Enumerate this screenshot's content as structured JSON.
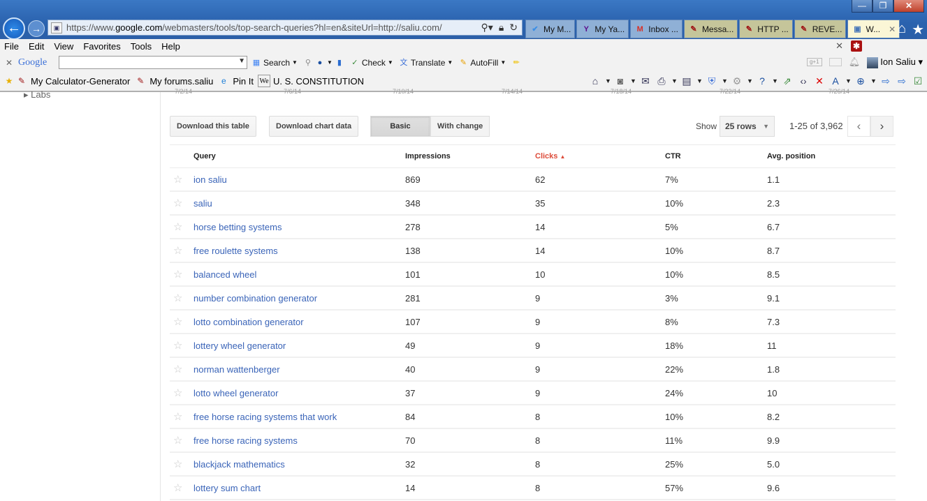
{
  "browser": {
    "url_scheme": "https://www.",
    "url_host": "google.com",
    "url_path": "/webmasters/tools/top-search-queries?hl=en&siteUrl=http://saliu.com/",
    "window_buttons": {
      "minimize": "—",
      "restore": "❐",
      "close": "✕"
    },
    "tabs": [
      {
        "label": "My M...",
        "icon": "✔",
        "style": "normal",
        "color": "#3a8ee6"
      },
      {
        "label": "My Ya...",
        "icon": "Y",
        "style": "normal",
        "color": "#5c0f8b"
      },
      {
        "label": "Inbox ...",
        "icon": "M",
        "style": "normal",
        "color": "#d93025"
      },
      {
        "label": "Messa...",
        "icon": "✎",
        "style": "olive",
        "color": "#a01818"
      },
      {
        "label": "HTTP ...",
        "icon": "✎",
        "style": "olive",
        "color": "#a01818"
      },
      {
        "label": "REVE...",
        "icon": "✎",
        "style": "olive",
        "color": "#a01818"
      },
      {
        "label": "W...",
        "icon": "▣",
        "style": "active",
        "color": "#4a78b8",
        "closable": true
      }
    ],
    "menu": [
      "File",
      "Edit",
      "View",
      "Favorites",
      "Tools",
      "Help"
    ],
    "google_toolbar": {
      "logo": "Google",
      "search_value": "",
      "items": [
        "Search",
        "Check",
        "Translate",
        "AutoFill"
      ],
      "user": "Ion Saliu"
    },
    "favorites": [
      {
        "label": "My Calculator-Generator",
        "icon": "✎"
      },
      {
        "label": "My forums.saliu",
        "icon": "✎"
      },
      {
        "label": "Pin It",
        "icon": "e"
      },
      {
        "label": "U. S. CONSTITUTION",
        "icon": "W"
      }
    ]
  },
  "sidebar": {
    "labs": "Labs"
  },
  "chart_ticks": [
    "7/2/14",
    "7/6/14",
    "7/10/14",
    "7/14/14",
    "7/18/14",
    "7/22/14",
    "7/26/14"
  ],
  "controls": {
    "download_table": "Download this table",
    "download_chart": "Download chart data",
    "view_basic": "Basic",
    "view_change": "With change",
    "show_label": "Show",
    "rows_selected": "25 rows",
    "page_range": "1-25 of 3,962",
    "prev": "‹",
    "next": "›"
  },
  "table": {
    "headers": {
      "query": "Query",
      "impressions": "Impressions",
      "clicks": "Clicks",
      "ctr": "CTR",
      "position": "Avg. position"
    },
    "sort_indicator": "▲",
    "accent_color": "#dd4b39",
    "rows": [
      {
        "query": "ion saliu",
        "impressions": "869",
        "clicks": "62",
        "ctr": "7%",
        "position": "1.1"
      },
      {
        "query": "saliu",
        "impressions": "348",
        "clicks": "35",
        "ctr": "10%",
        "position": "2.3"
      },
      {
        "query": "horse betting systems",
        "impressions": "278",
        "clicks": "14",
        "ctr": "5%",
        "position": "6.7"
      },
      {
        "query": "free roulette systems",
        "impressions": "138",
        "clicks": "14",
        "ctr": "10%",
        "position": "8.7"
      },
      {
        "query": "balanced wheel",
        "impressions": "101",
        "clicks": "10",
        "ctr": "10%",
        "position": "8.5"
      },
      {
        "query": "number combination generator",
        "impressions": "281",
        "clicks": "9",
        "ctr": "3%",
        "position": "9.1"
      },
      {
        "query": "lotto combination generator",
        "impressions": "107",
        "clicks": "9",
        "ctr": "8%",
        "position": "7.3"
      },
      {
        "query": "lottery wheel generator",
        "impressions": "49",
        "clicks": "9",
        "ctr": "18%",
        "position": "11"
      },
      {
        "query": "norman wattenberger",
        "impressions": "40",
        "clicks": "9",
        "ctr": "22%",
        "position": "1.8"
      },
      {
        "query": "lotto wheel generator",
        "impressions": "37",
        "clicks": "9",
        "ctr": "24%",
        "position": "10"
      },
      {
        "query": "free horse racing systems that work",
        "impressions": "84",
        "clicks": "8",
        "ctr": "10%",
        "position": "8.2"
      },
      {
        "query": "free horse racing systems",
        "impressions": "70",
        "clicks": "8",
        "ctr": "11%",
        "position": "9.9"
      },
      {
        "query": "blackjack mathematics",
        "impressions": "32",
        "clicks": "8",
        "ctr": "25%",
        "position": "5.0"
      },
      {
        "query": "lottery sum chart",
        "impressions": "14",
        "clicks": "8",
        "ctr": "57%",
        "position": "9.6"
      }
    ]
  }
}
